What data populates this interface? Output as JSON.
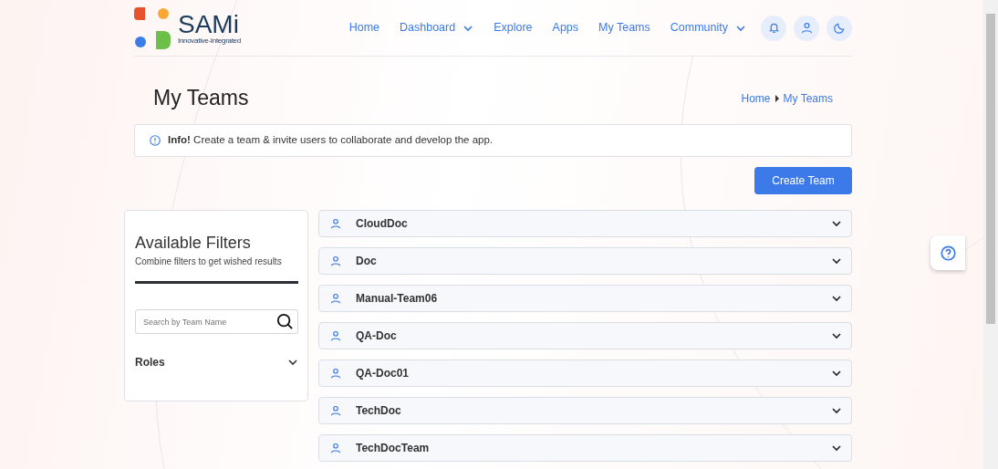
{
  "logo": {
    "name": "SAMi",
    "tagline": "Innovative-Integrated"
  },
  "nav": [
    {
      "label": "Home",
      "dropdown": false
    },
    {
      "label": "Dashboard",
      "dropdown": true
    },
    {
      "label": "Explore",
      "dropdown": false
    },
    {
      "label": "Apps",
      "dropdown": false
    },
    {
      "label": "My Teams",
      "dropdown": false
    },
    {
      "label": "Community",
      "dropdown": true
    }
  ],
  "page_title": "My Teams",
  "breadcrumb": [
    "Home",
    "My Teams"
  ],
  "info": {
    "label": "Info!",
    "text": "Create a team & invite users to collaborate and develop the app."
  },
  "create_button": "Create Team",
  "filters": {
    "title": "Available Filters",
    "subtitle": "Combine filters to get wished results",
    "search": {
      "placeholder": "Search by Team Name"
    },
    "sections": [
      {
        "label": "Roles",
        "expanded": false
      }
    ]
  },
  "teams": [
    {
      "name": "CloudDoc",
      "expanded": false
    },
    {
      "name": "Doc",
      "expanded": false
    },
    {
      "name": "Manual-Team06",
      "expanded": false
    },
    {
      "name": "QA-Doc",
      "expanded": false
    },
    {
      "name": "QA-Doc01",
      "expanded": false
    },
    {
      "name": "TechDoc",
      "expanded": false
    },
    {
      "name": "TechDocTeam",
      "expanded": false
    }
  ]
}
